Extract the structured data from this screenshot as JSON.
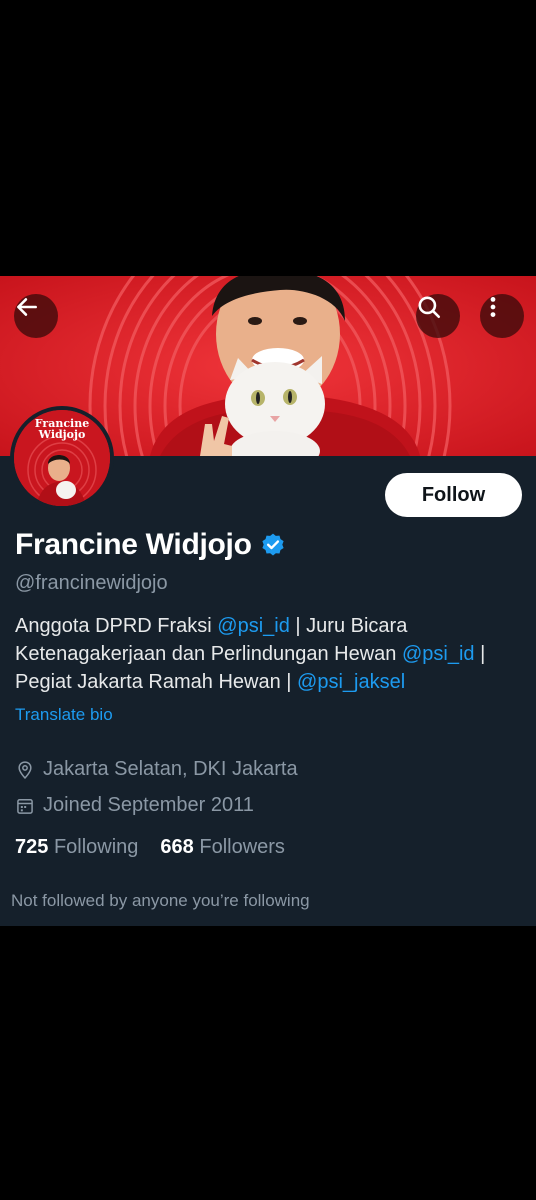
{
  "profile": {
    "name": "Francine Widjojo",
    "handle": "@francinewidjojo",
    "bio": {
      "part1": "Anggota DPRD Fraksi ",
      "mention1": "@psi_id",
      "part2": " | Juru Bicara Ketenagakerjaan dan Perlindungan Hewan ",
      "mention2": "@psi_id",
      "part3": " | Pegiat Jakarta Ramah Hewan | ",
      "mention3": "@psi_jaksel"
    },
    "translate_label": "Translate bio",
    "location": "Jakarta Selatan, DKI Jakarta",
    "joined": "Joined September 2011",
    "following_count": "725",
    "following_label": "Following",
    "followers_count": "668",
    "followers_label": "Followers",
    "not_followed_text": "Not followed by anyone you’re following",
    "avatar_text": {
      "line1": "Francine",
      "line2": "Widjojo"
    }
  },
  "actions": {
    "follow_label": "Follow"
  },
  "icons": {
    "back": "arrow-left-icon",
    "search": "search-icon",
    "more": "more-vertical-icon",
    "verified": "verified-badge-icon",
    "location": "location-pin-icon",
    "calendar": "calendar-icon"
  },
  "colors": {
    "background": "#15202b",
    "accent": "#1d9bf0",
    "banner_red": "#d91d26",
    "muted_text": "#8b98a5"
  }
}
